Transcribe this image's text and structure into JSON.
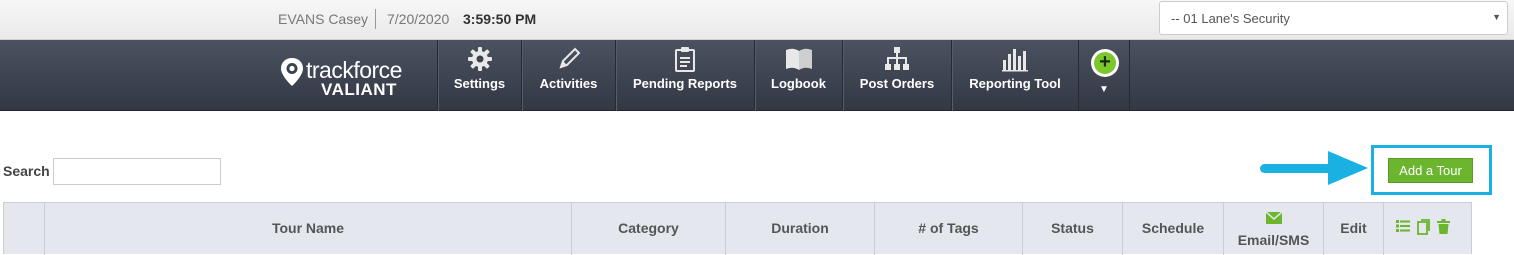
{
  "header": {
    "user": "EVANS Casey",
    "date": "7/20/2020",
    "time": "3:59:50 PM",
    "site_select": "-- 01 Lane's Security"
  },
  "logo": {
    "line1": "trackforce",
    "line2": "VALIANT"
  },
  "nav": {
    "items": [
      {
        "label": "Settings",
        "icon": "gear-icon"
      },
      {
        "label": "Activities",
        "icon": "pencil-icon"
      },
      {
        "label": "Pending Reports",
        "icon": "clipboard-icon"
      },
      {
        "label": "Logbook",
        "icon": "book-icon"
      },
      {
        "label": "Post Orders",
        "icon": "org-chart-icon"
      },
      {
        "label": "Reporting Tool",
        "icon": "bar-chart-icon"
      }
    ],
    "add_icon": "plus-circle-icon"
  },
  "search": {
    "label": "Search",
    "value": ""
  },
  "actions": {
    "add_tour": "Add a Tour"
  },
  "table": {
    "columns": [
      "",
      "Tour Name",
      "Category",
      "Duration",
      "# of Tags",
      "Status",
      "Schedule",
      "Email/SMS",
      "Edit",
      ""
    ],
    "header_icons": [
      "list-icon",
      "copy-icon",
      "trash-icon"
    ]
  },
  "colors": {
    "nav_bg": "#3c424f",
    "accent_green": "#6cb52f",
    "highlight_blue": "#1ab1e2"
  }
}
